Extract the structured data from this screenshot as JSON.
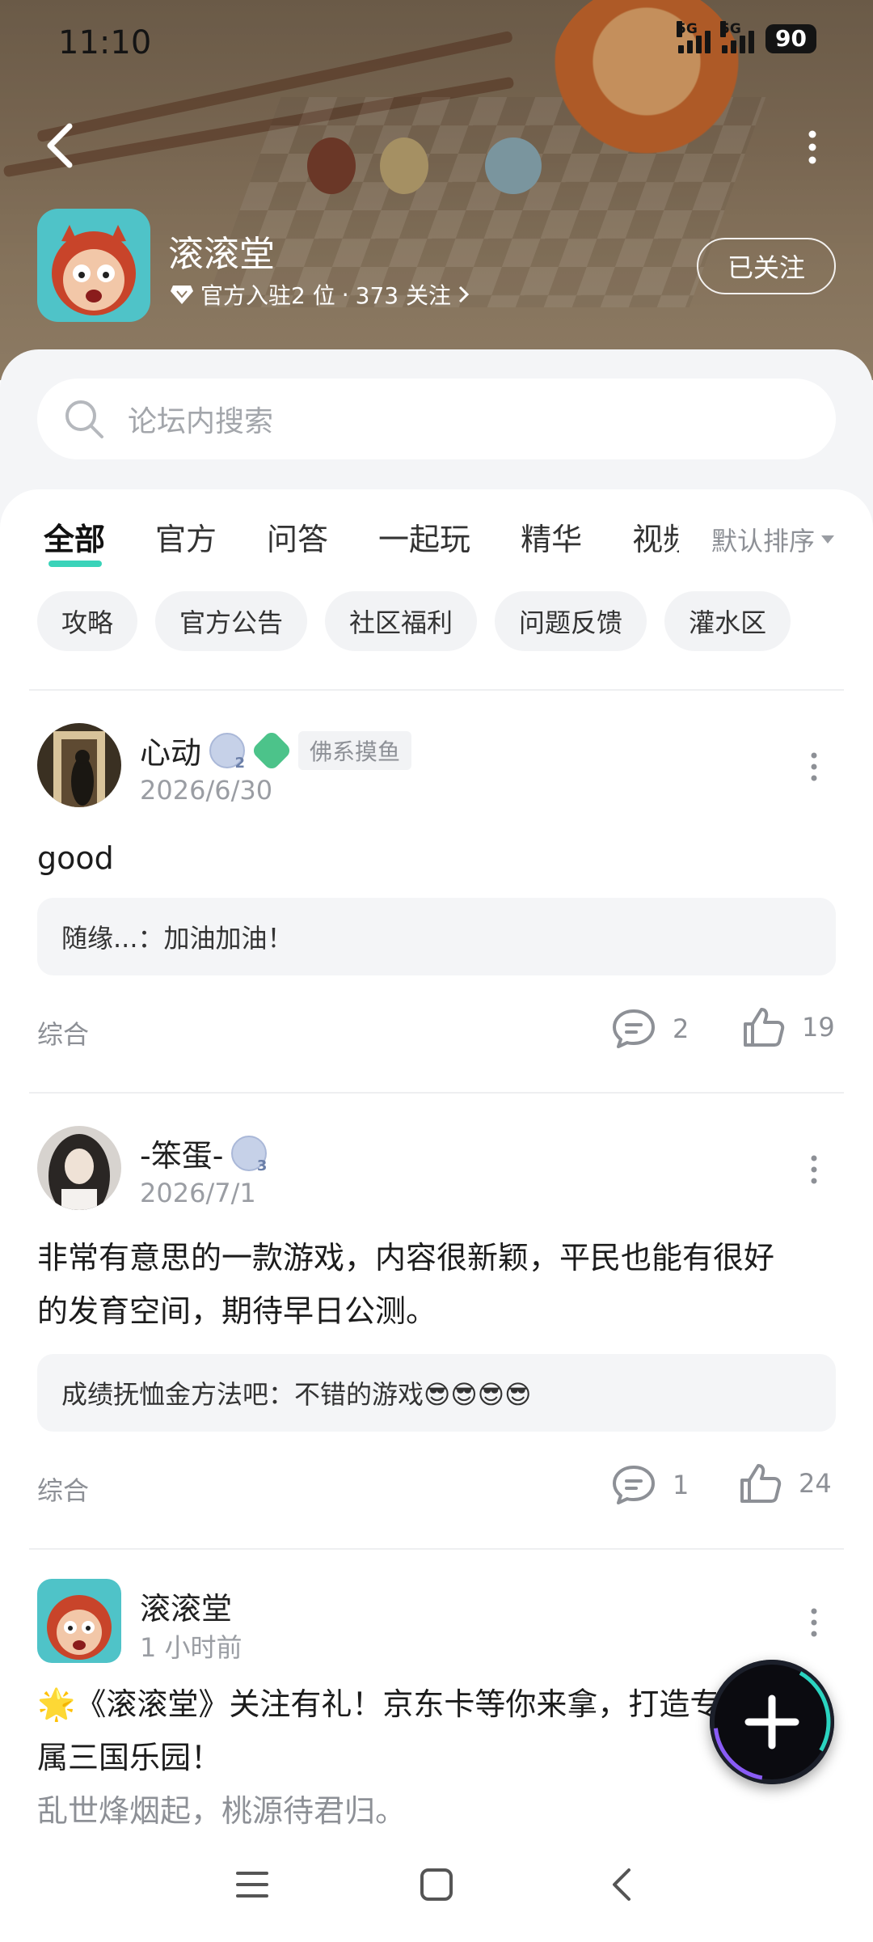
{
  "status_bar": {
    "time": "11:10",
    "signal_1_label": "5G",
    "signal_2_label": "5G",
    "battery": "90"
  },
  "header": {
    "app_name": "滚滚堂",
    "rank_text": "官方入驻2 位",
    "separator": "·",
    "follow_count_text": "373 关注",
    "follow_button": "已关注"
  },
  "search": {
    "placeholder": "论坛内搜索"
  },
  "tabs": [
    {
      "label": "全部",
      "active": true
    },
    {
      "label": "官方"
    },
    {
      "label": "问答"
    },
    {
      "label": "一起玩"
    },
    {
      "label": "精华"
    },
    {
      "label": "视频"
    }
  ],
  "sort": {
    "label": "默认排序"
  },
  "chips": [
    "攻略",
    "官方公告",
    "社区福利",
    "问题反馈",
    "灌水区"
  ],
  "posts": [
    {
      "author": "心动",
      "level": "2",
      "tag": "佛系摸鱼",
      "date": "2026/6/30",
      "body": "good",
      "reply": "随缘...：加油加油！",
      "category": "综合",
      "comments": "2",
      "likes": "19"
    },
    {
      "author": "-笨蛋-",
      "level": "3",
      "date": "2026/7/1",
      "body_line1": "非常有意思的一款游戏，内容很新颖，平民也能有很好",
      "body_line2": "的发育空间，期待早日公测。",
      "reply": "成绩抚恤金方法吧：不错的游戏😎😎😎😎",
      "category": "综合",
      "comments": "1",
      "likes": "24"
    },
    {
      "author": "滚滚堂",
      "date": "1 小时前",
      "body_line1": "🌟《滚滚堂》关注有礼！京东卡等你来拿，打造专",
      "body_line2": "属三国乐园！",
      "body_line3": "乱世烽烟起，桃源待君归。"
    }
  ],
  "colors": {
    "accent": "#3ad3b9",
    "hero_bg": "#8d7a62",
    "muted_text": "#8d9096"
  }
}
